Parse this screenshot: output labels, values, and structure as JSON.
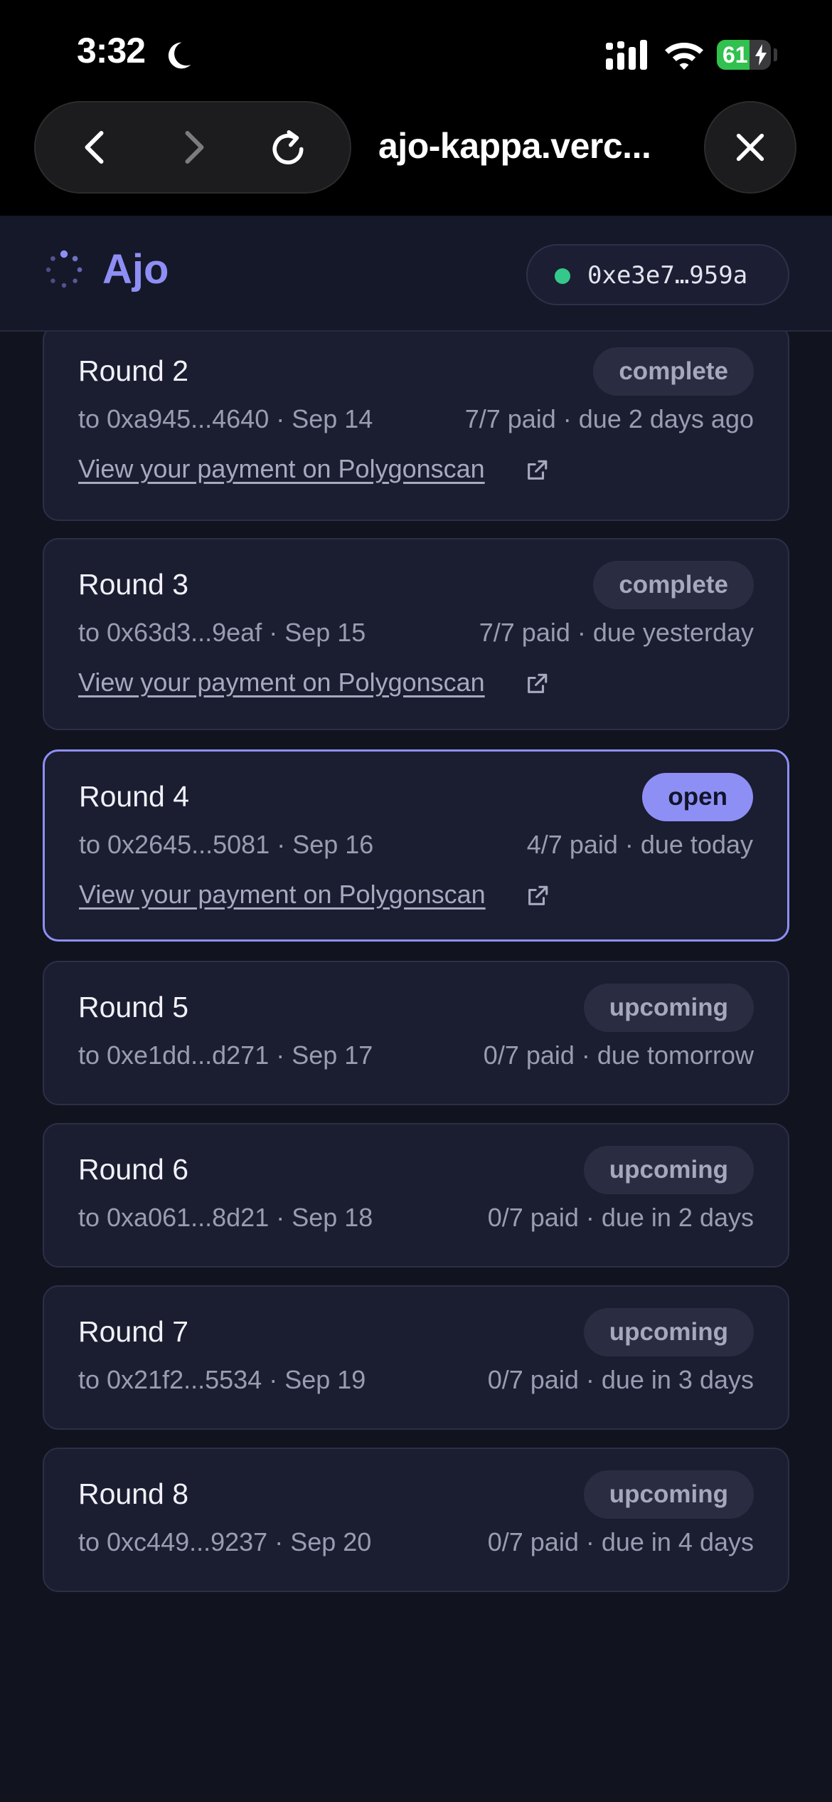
{
  "status_bar": {
    "time": "3:32",
    "battery": "61",
    "battery_level": 0.61
  },
  "browser": {
    "url": "ajo-kappa.verc..."
  },
  "app": {
    "brand": "Ajo",
    "wallet_address": "0xe3e7…959a"
  },
  "rounds": [
    {
      "title": "Round 2",
      "recipient_date": "to 0xa945...4640 · Sep 14",
      "progress": "7/7 paid · due 2 days ago",
      "badge": "complete",
      "link": "View your payment on Polygonscan"
    },
    {
      "title": "Round 3",
      "recipient_date": "to 0x63d3...9eaf · Sep 15",
      "progress": "7/7 paid · due yesterday",
      "badge": "complete",
      "link": "View your payment on Polygonscan"
    },
    {
      "title": "Round 4",
      "recipient_date": "to 0x2645...5081 · Sep 16",
      "progress": "4/7 paid · due today",
      "badge": "open",
      "link": "View your payment on Polygonscan"
    },
    {
      "title": "Round 5",
      "recipient_date": "to 0xe1dd...d271 · Sep 17",
      "progress": "0/7 paid · due tomorrow",
      "badge": "upcoming"
    },
    {
      "title": "Round 6",
      "recipient_date": "to 0xa061...8d21 · Sep 18",
      "progress": "0/7 paid · due in 2 days",
      "badge": "upcoming"
    },
    {
      "title": "Round 7",
      "recipient_date": "to 0x21f2...5534 · Sep 19",
      "progress": "0/7 paid · due in 3 days",
      "badge": "upcoming"
    },
    {
      "title": "Round 8",
      "recipient_date": "to 0xc449...9237 · Sep 20",
      "progress": "0/7 paid · due in 4 days",
      "badge": "upcoming"
    }
  ],
  "colors": {
    "accent": "#8e8ff5",
    "background": "#11131f",
    "card": "#1b1d30",
    "online": "#34c98b"
  }
}
